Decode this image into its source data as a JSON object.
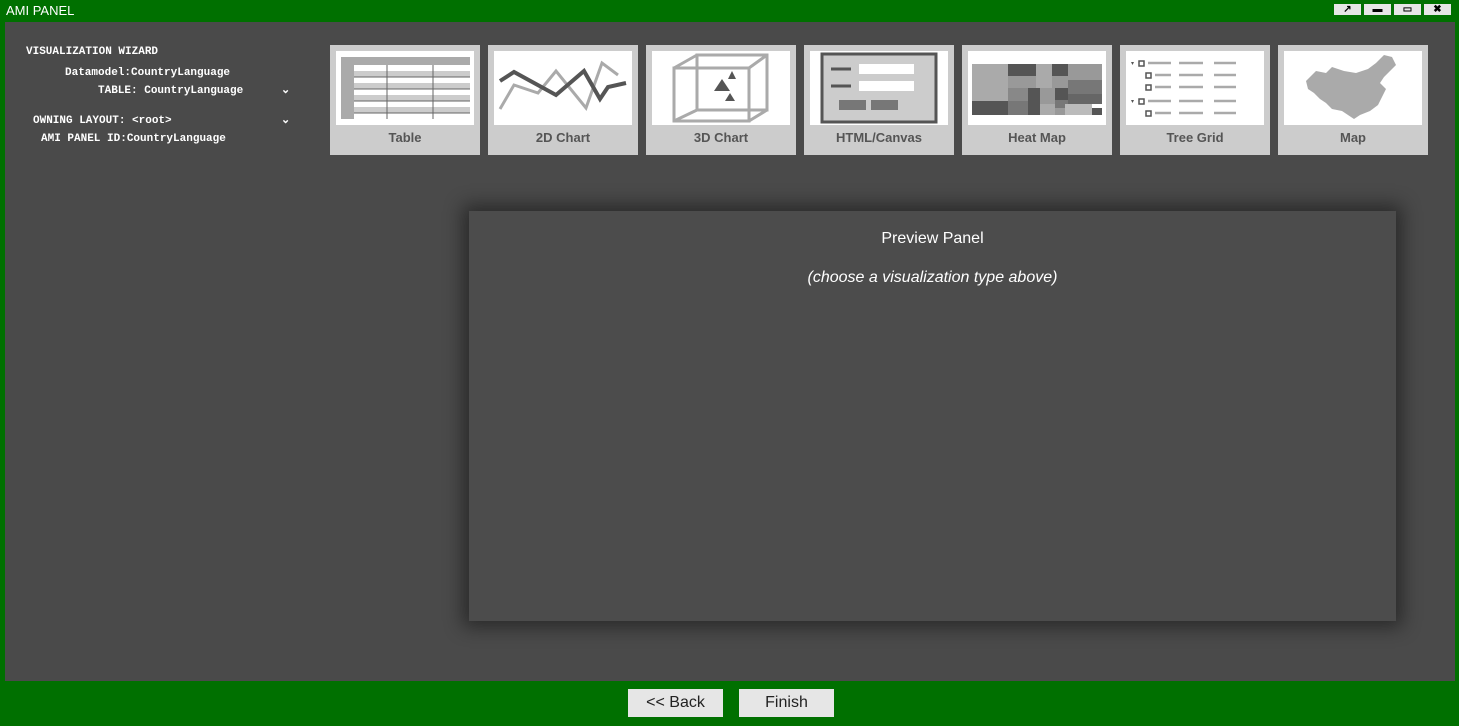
{
  "window": {
    "title": "AMI PANEL",
    "controls": [
      "pop-out",
      "minimize",
      "maximize",
      "close"
    ]
  },
  "wizard": {
    "heading": "VISUALIZATION WIZARD",
    "datamodel_label": "Datamodel:",
    "datamodel_value": "CountryLanguage",
    "table_label": "TABLE:",
    "table_value": "CountryLanguage",
    "layout_label": "OWNING LAYOUT:",
    "layout_value": "<root>",
    "panel_id_label": "AMI PANEL ID:",
    "panel_id_value": "CountryLanguage"
  },
  "tiles": [
    {
      "label": "Table"
    },
    {
      "label": "2D Chart"
    },
    {
      "label": "3D Chart"
    },
    {
      "label": "HTML/Canvas"
    },
    {
      "label": "Heat Map"
    },
    {
      "label": "Tree Grid"
    },
    {
      "label": "Map"
    }
  ],
  "preview": {
    "title": "Preview Panel",
    "subtitle": "(choose a visualization type above)"
  },
  "footer": {
    "back_label": "<< Back",
    "finish_label": "Finish"
  },
  "colors": {
    "frame": "#007000",
    "background": "#4a4a4a",
    "tile": "#cccccc"
  }
}
